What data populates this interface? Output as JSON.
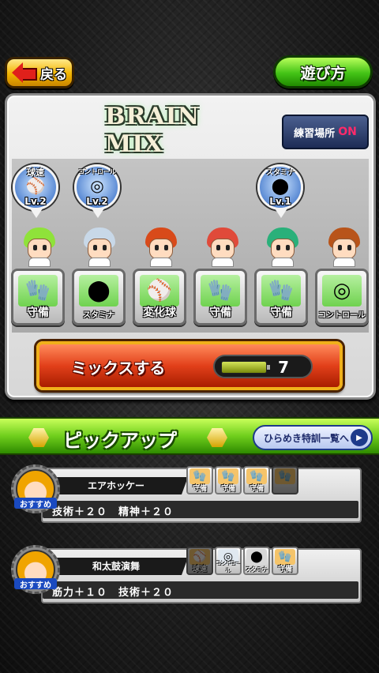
{
  "header": {
    "back_label": "戻る",
    "howto_label": "遊び方"
  },
  "panel": {
    "logo_text": "BRAIN MIX",
    "practice": {
      "label": "練習場所",
      "state": "ON"
    }
  },
  "bubbles": [
    {
      "title": "球速",
      "level": "Lv.2",
      "icon": "fastball-icon"
    },
    {
      "title": "コントロール",
      "level": "Lv.2",
      "icon": "target-icon"
    },
    {
      "title": "スタミナ",
      "level": "Lv.1",
      "icon": "stamina-icon"
    }
  ],
  "cards": [
    {
      "label": "守備",
      "icon": "glove-icon",
      "hair": "#8fe23a"
    },
    {
      "label": "スタミナ",
      "icon": "stamina-icon",
      "hair": "#c8d8e8"
    },
    {
      "label": "変化球",
      "icon": "breaking-ball-icon",
      "hair": "#d84a1a"
    },
    {
      "label": "守備",
      "icon": "glove-icon",
      "hair": "#e04a3a"
    },
    {
      "label": "守備",
      "icon": "glove-icon",
      "hair": "#2ab07a"
    },
    {
      "label": "コントロール",
      "icon": "target-icon",
      "hair": "#b8541a"
    }
  ],
  "mix": {
    "label": "ミックスする",
    "battery_text": "Wisdom Battery",
    "count": "7"
  },
  "pickup": {
    "title": "ピックアップ",
    "list_button": "ひらめき特訓一覧へ",
    "items": [
      {
        "name": "エアホッケー",
        "stats": "技術＋２０　精神＋２０",
        "badge": "おすすめ",
        "skills": [
          {
            "label": "守備",
            "dim": false
          },
          {
            "label": "守備",
            "dim": false
          },
          {
            "label": "守備",
            "dim": false
          },
          {
            "label": "",
            "dim": true
          }
        ]
      },
      {
        "name": "和太鼓演舞",
        "stats": "筋力＋１０　技術＋２０",
        "badge": "おすすめ",
        "skills": [
          {
            "label": "球速",
            "dim": true
          },
          {
            "label": "コントロール",
            "dim": false
          },
          {
            "label": "スタミナ",
            "dim": false
          },
          {
            "label": "守備",
            "dim": false
          }
        ]
      }
    ]
  }
}
